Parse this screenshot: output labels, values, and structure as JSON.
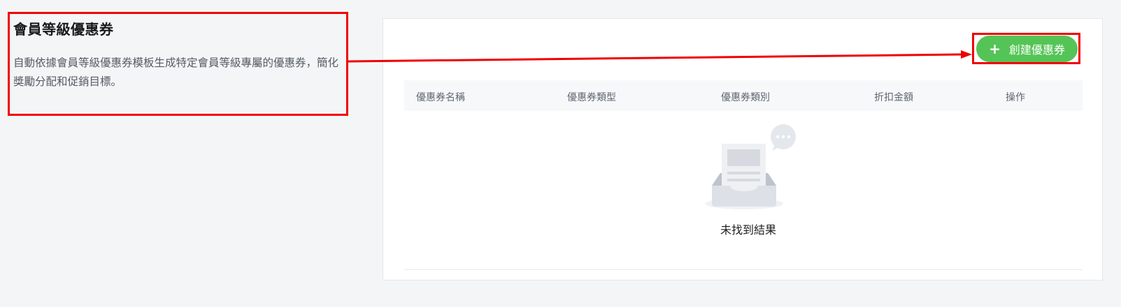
{
  "intro": {
    "title": "會員等級優惠券",
    "description": "自動依據會員等級優惠券模板生成特定會員等級專屬的優惠券，簡化獎勵分配和促銷目標。"
  },
  "toolbar": {
    "create_label": "創建優惠券",
    "create_icon": "plus-icon"
  },
  "table": {
    "columns": [
      "優惠券名稱",
      "優惠券類型",
      "優惠券類別",
      "折扣金額",
      "操作"
    ],
    "rows": [],
    "empty_text": "未找到結果"
  },
  "colors": {
    "accent": "#55c456",
    "annotation": "#f00000",
    "background": "#f4f5f7"
  }
}
